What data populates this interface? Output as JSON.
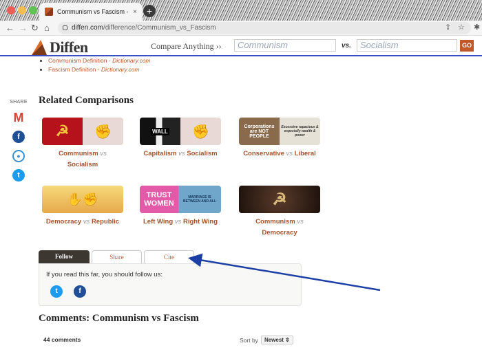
{
  "browser": {
    "tab_title": "Communism vs Fascism - Diffe",
    "tab_close": "×",
    "new_tab": "+",
    "url_domain": "diffen.com",
    "url_path": "/difference/Communism_vs_Fascism"
  },
  "site": {
    "logo": "Diffen",
    "compare_label": "Compare Anything ››",
    "input1_placeholder": "Communism",
    "vs_label": "vs.",
    "input2_placeholder": "Socialism",
    "go_label": "GO"
  },
  "definitions": [
    {
      "label": "Communism Definition - ",
      "source": "Dictionary.com"
    },
    {
      "label": "Fascism Definition - ",
      "source": "Dictionary.com"
    }
  ],
  "share_rail": {
    "label": "SHARE"
  },
  "related": {
    "title": "Related Comparisons",
    "vs": "vs",
    "cards": [
      {
        "a": "Communism",
        "b": "Socialism"
      },
      {
        "a": "Capitalism",
        "b": "Socialism"
      },
      {
        "a": "Conservative",
        "b": "Liberal"
      },
      {
        "a": "Democracy",
        "b": "Republic"
      },
      {
        "a": "Left Wing",
        "b": "Right Wing"
      },
      {
        "a": "Communism",
        "b": "Democracy"
      }
    ],
    "thumb_text": {
      "wall": "WALL",
      "corp1": "Corporations are NOT PEOPLE",
      "corp2": "Excessive rapacious & especially wealth & power",
      "trust": "TRUST WOMEN",
      "marriage": "MARRIAGE IS BETWEEN AND ALL"
    }
  },
  "follow_tabs": {
    "tabs": [
      "Follow",
      "Share",
      "Cite"
    ],
    "message": "If you read this far, you should follow us:"
  },
  "comments": {
    "title": "Comments: Communism vs Fascism",
    "count": "44 comments",
    "sort_label": "Sort by",
    "sort_value": "Newest ⇕"
  },
  "colors": {
    "accent": "#c0582a",
    "header_rule": "#3b4fc4",
    "arrow": "#1b3fa5"
  }
}
